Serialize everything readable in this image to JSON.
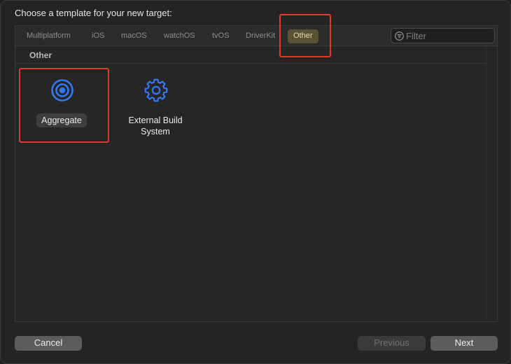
{
  "dialog": {
    "title": "Choose a template for your new target:"
  },
  "tabs": [
    {
      "label": "Multiplatform"
    },
    {
      "label": "iOS"
    },
    {
      "label": "macOS"
    },
    {
      "label": "watchOS"
    },
    {
      "label": "tvOS"
    },
    {
      "label": "DriverKit"
    },
    {
      "label": "Other",
      "selected": true
    }
  ],
  "filter": {
    "placeholder": "Filter",
    "value": "",
    "icon": "filter-circle-icon"
  },
  "section": {
    "label": "Other"
  },
  "templates": [
    {
      "label": "Aggregate",
      "icon": "target-icon",
      "selected": true
    },
    {
      "label_line1": "External Build",
      "label_line2": "System",
      "icon": "gear-icon",
      "selected": false
    }
  ],
  "footer": {
    "cancel_label": "Cancel",
    "previous_label": "Previous",
    "next_label": "Next"
  },
  "colors": {
    "accent": "#3478f6",
    "selected_tab_bg": "#5b5133",
    "highlight": "#e03a2f"
  }
}
